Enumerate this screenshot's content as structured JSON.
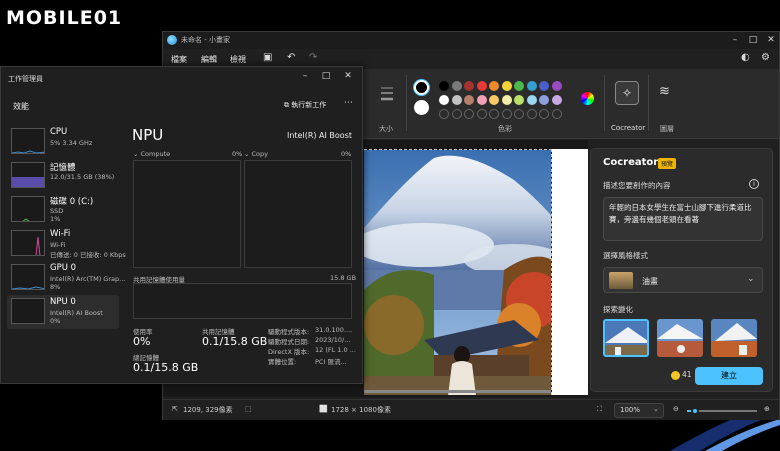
{
  "watermark": {
    "text": "MOBILE01"
  },
  "paint": {
    "title": "未命名 - 小畫家",
    "menu": [
      "檔案",
      "編輯",
      "檢視"
    ],
    "ribbon": {
      "size_label": "大小",
      "colors_label": "色彩",
      "cocreator_label": "Cocreator",
      "layers_label": "圖層"
    },
    "palette_row1": [
      "#000000",
      "#7a7a7a",
      "#a83232",
      "#e63a3a",
      "#f08a2a",
      "#f5d33a",
      "#4cb84c",
      "#35a0d0",
      "#4b5fc8",
      "#9a4bc0"
    ],
    "palette_row2": [
      "#ffffff",
      "#c3c3c3",
      "#b5806a",
      "#f2a0b5",
      "#f5c86a",
      "#f5eeaa",
      "#b9e06a",
      "#9ad6ef",
      "#8fa0dc",
      "#c8a8e0"
    ],
    "status": {
      "cursor": "1209, 329像素",
      "canvas_size": "1728 × 1080像素",
      "zoom": "100%"
    }
  },
  "cocreator": {
    "title": "Cocreator",
    "badge": "預覽",
    "describe_label": "描述您要創作的內容",
    "prompt": "年輕的日本女學生在富士山腳下進行柔道比賽，旁邊有幾個老頭在看著",
    "style_label": "選擇風格樣式",
    "style_value": "油畫",
    "explore_label": "探索變化",
    "credits": "41",
    "create_button": "建立"
  },
  "task_manager": {
    "title": "工作管理員",
    "section": "效能",
    "run_task": "執行新工作",
    "items": [
      {
        "name": "CPU",
        "l2": "5% 3.34 GHz",
        "l3": ""
      },
      {
        "name": "記憶體",
        "l2": "12.0/31.5 GB (38%)",
        "l3": ""
      },
      {
        "name": "磁碟 0 (C:)",
        "l2": "SSD",
        "l3": "1%"
      },
      {
        "name": "Wi-Fi",
        "l2": "Wi-Fi",
        "l3": "已傳送: 0 已接收: 0 Kbps"
      },
      {
        "name": "GPU 0",
        "l2": "Intel(R) Arc(TM) Grap...",
        "l3": "8%"
      },
      {
        "name": "NPU 0",
        "l2": "Intel(R) AI Boost",
        "l3": "0%"
      }
    ],
    "detail": {
      "heading": "NPU",
      "device": "Intel(R) AI Boost",
      "graph1_label": "Compute",
      "graph1_pct": "0%",
      "graph2_label": "Copy",
      "graph2_pct": "0%",
      "shared_mem_label": "共用記憶體使用量",
      "shared_mem_max": "15.8 GB",
      "util_label": "使用率",
      "util_value": "0%",
      "shared_label": "共用記憶體",
      "shared_value": "0.1/15.8 GB",
      "total_label": "總記憶體",
      "total_value": "0.1/15.8 GB",
      "driver_version_label": "驅動程式版本:",
      "driver_version": "31.0.100....",
      "driver_date_label": "驅動程式日期:",
      "driver_date": "2023/10/...",
      "directx_label": "DirectX 版本:",
      "directx": "12 (FL 1.0 ...",
      "location_label": "實體位置:",
      "location": "PCI 匯流..."
    }
  }
}
